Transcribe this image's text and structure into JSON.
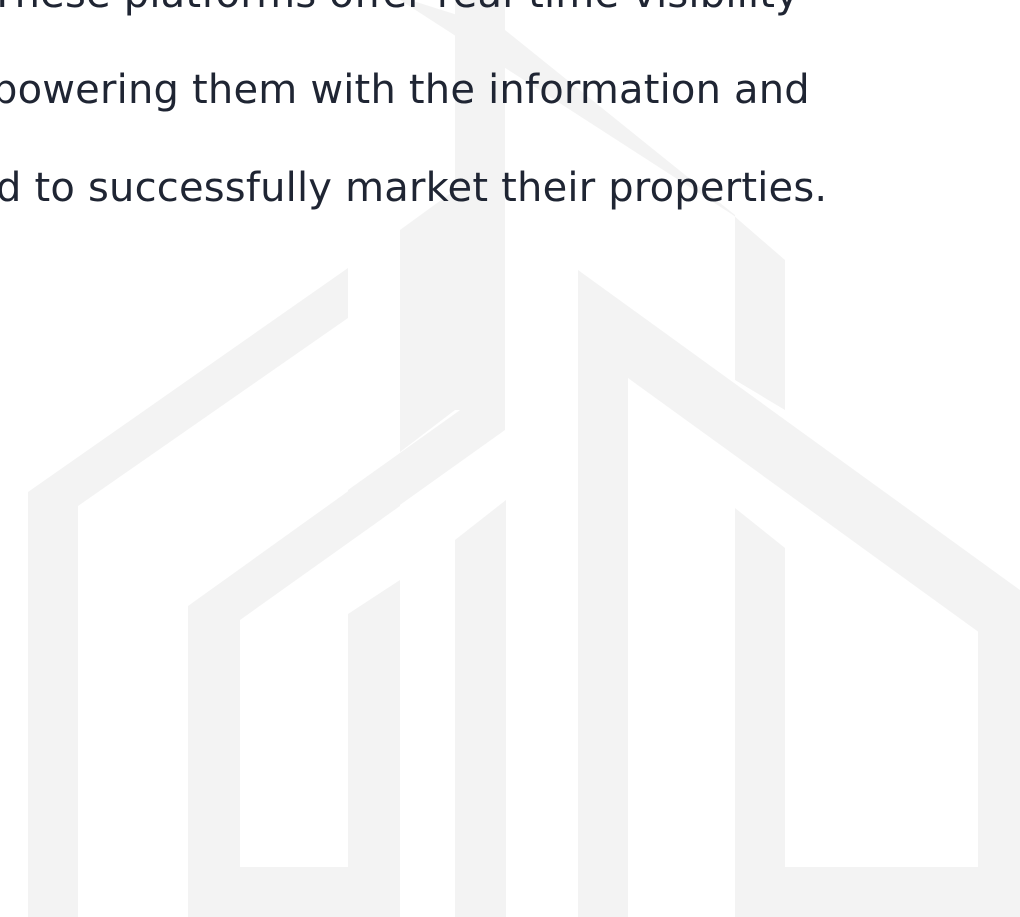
{
  "paragraph": {
    "line_1": "These platforms offer real-time visibility",
    "line_2": "powering them with the information and",
    "line_3": "d to successfully market their properties."
  },
  "colors": {
    "text": "#1f2533",
    "background": "#ffffff",
    "watermark": "#f3f3f3"
  },
  "watermark": {
    "icon": "building-logo-icon"
  }
}
